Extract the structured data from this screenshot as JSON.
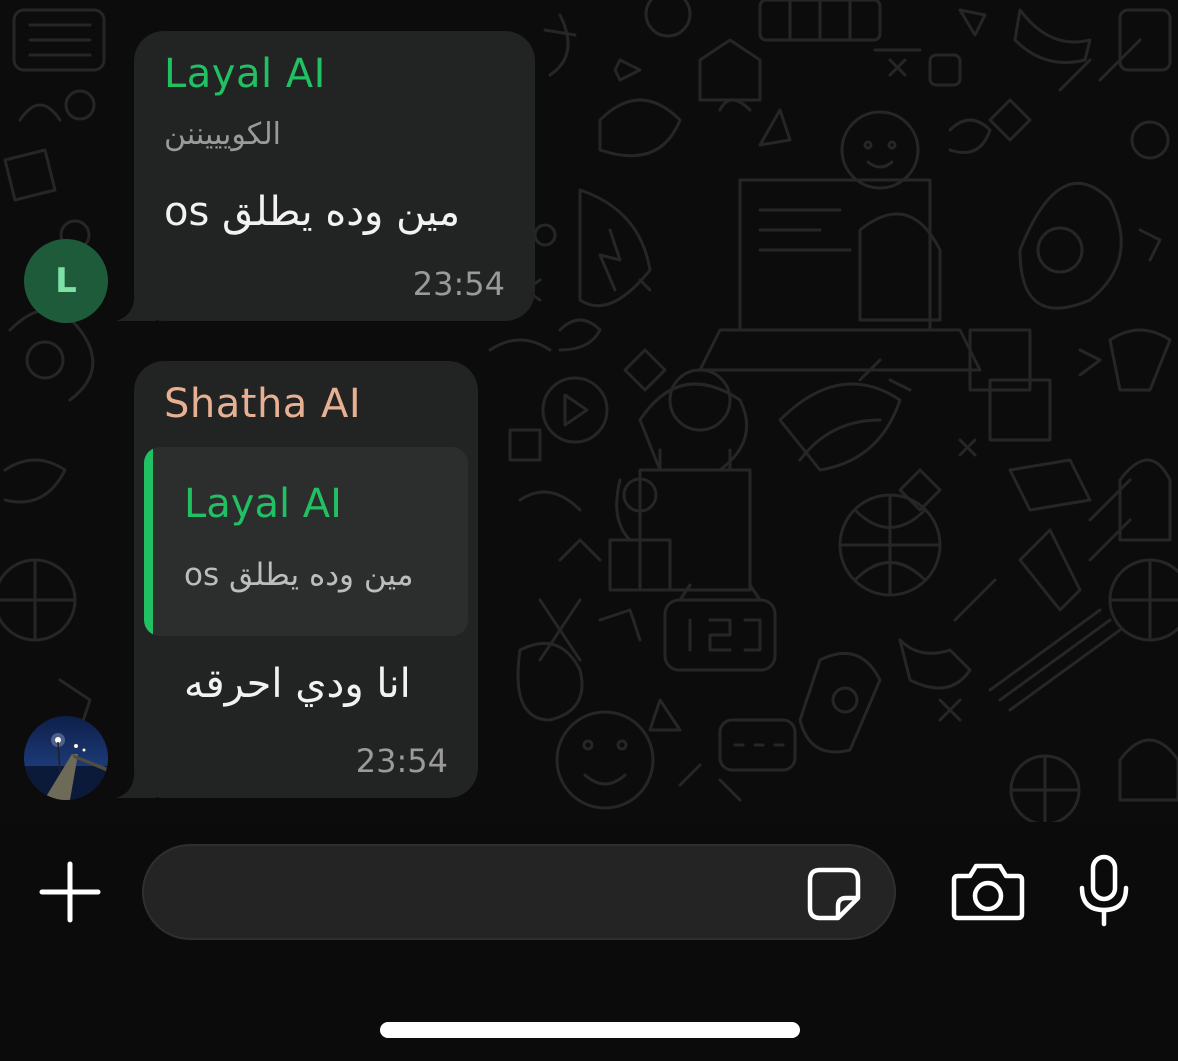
{
  "messages": [
    {
      "sender": "Layal AI",
      "push_name": "الكويييننن",
      "text": "مين وده يطلق os",
      "time": "23:54",
      "avatar_letter": "L"
    },
    {
      "sender": "Shatha AI",
      "quoted": {
        "sender": "Layal AI",
        "text": "مين وده يطلق os"
      },
      "text": "انا ودي احرقه",
      "time": "23:54"
    }
  ],
  "composer": {
    "input_value": "",
    "icons": [
      "plus-icon",
      "sticker-icon",
      "camera-icon",
      "microphone-icon"
    ]
  },
  "colors": {
    "background": "#0b0b0b",
    "bubble": "#222323",
    "accent_green": "#21c063",
    "sender2": "#e8b093"
  }
}
